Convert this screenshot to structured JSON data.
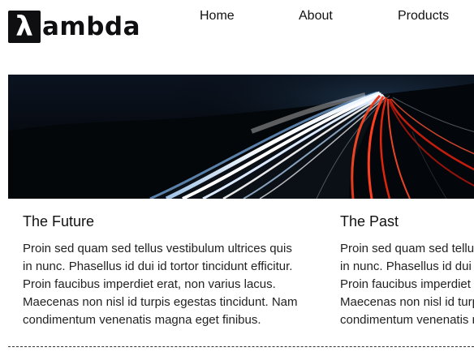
{
  "brand": {
    "logo_mark": "λ",
    "logo_text": "ambda"
  },
  "nav": {
    "items": [
      {
        "label": "Home"
      },
      {
        "label": "About"
      },
      {
        "label": "Products"
      }
    ]
  },
  "hero": {
    "icon": "highway-light-trails-photo"
  },
  "articles": [
    {
      "title": "The Future",
      "lines": [
        "Proin sed quam sed tellus vestibulum ultrices quis",
        "in nunc. Phasellus id dui id tortor tincidunt efficitur.",
        "Proin faucibus imperdiet erat, non varius lacus.",
        "Maecenas non nisl id turpis egestas tincidunt. Nam",
        "condimentum venenatis magna eget finibus."
      ]
    },
    {
      "title": "The Past",
      "lines": [
        "Proin sed quam sed tellus vestibulum ultrices quis",
        "in nunc. Phasellus id dui id tortor tincidunt efficitur.",
        "Proin faucibus imperdiet erat, non varius lacus.",
        "Maecenas non nisl id turpis egestas tincidunt. Nam",
        "condimentum venenatis magna eget finibus."
      ]
    }
  ]
}
